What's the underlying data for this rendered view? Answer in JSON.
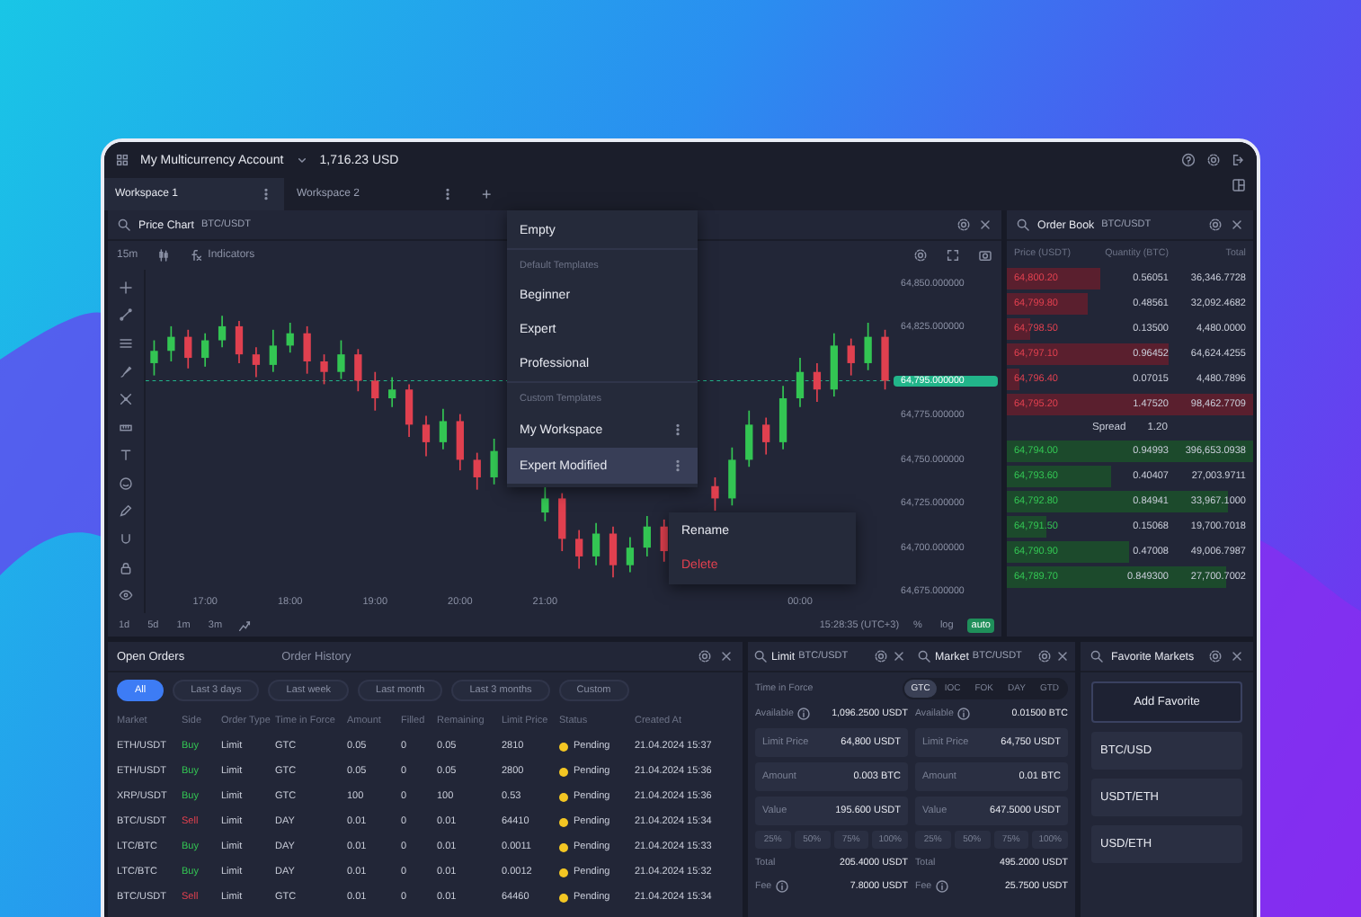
{
  "top_bar": {
    "account": "My Multicurrency Account",
    "balance": "1,716.23 USD"
  },
  "workspaces": [
    {
      "label": "Workspace 1",
      "selected": true
    },
    {
      "label": "Workspace 2",
      "selected": false
    }
  ],
  "add_tab": "+",
  "price_chart": {
    "title": "Price Chart",
    "pair": "BTC/USDT",
    "interval": "15m",
    "indicators": "Indicators",
    "chart_data": {
      "type": "candlestick",
      "x": [
        16.4,
        16.6,
        16.8,
        17.0,
        17.2,
        17.4,
        17.6,
        17.8,
        18.0,
        18.2,
        18.4,
        18.6,
        18.8,
        19.0,
        19.2,
        19.4,
        19.6,
        19.8,
        20.0,
        20.2,
        20.4,
        21.0,
        21.2,
        21.4,
        21.6,
        21.8,
        22.0,
        22.2,
        22.4,
        23.0,
        23.2,
        23.4,
        23.6,
        23.8,
        24.0,
        24.2,
        24.4,
        24.6,
        24.8,
        25.0
      ],
      "ohlc": [
        [
          64805,
          64818,
          64798,
          64812
        ],
        [
          64812,
          64826,
          64806,
          64820
        ],
        [
          64820,
          64824,
          64802,
          64808
        ],
        [
          64808,
          64822,
          64803,
          64818
        ],
        [
          64818,
          64832,
          64814,
          64826
        ],
        [
          64826,
          64829,
          64805,
          64810
        ],
        [
          64810,
          64814,
          64797,
          64804
        ],
        [
          64804,
          64824,
          64800,
          64815
        ],
        [
          64815,
          64828,
          64811,
          64822
        ],
        [
          64822,
          64826,
          64799,
          64806
        ],
        [
          64806,
          64810,
          64793,
          64800
        ],
        [
          64800,
          64818,
          64796,
          64810
        ],
        [
          64810,
          64813,
          64789,
          64795
        ],
        [
          64795,
          64800,
          64778,
          64785
        ],
        [
          64785,
          64797,
          64780,
          64790
        ],
        [
          64790,
          64793,
          64763,
          64770
        ],
        [
          64770,
          64775,
          64752,
          64760
        ],
        [
          64760,
          64779,
          64756,
          64772
        ],
        [
          64772,
          64776,
          64744,
          64750
        ],
        [
          64750,
          64754,
          64733,
          64740
        ],
        [
          64740,
          64762,
          64736,
          64755
        ],
        [
          64720,
          64735,
          64715,
          64728
        ],
        [
          64728,
          64731,
          64698,
          64705
        ],
        [
          64705,
          64710,
          64688,
          64695
        ],
        [
          64695,
          64714,
          64690,
          64708
        ],
        [
          64708,
          64712,
          64683,
          64690
        ],
        [
          64690,
          64706,
          64686,
          64700
        ],
        [
          64700,
          64718,
          64695,
          64712
        ],
        [
          64712,
          64716,
          64692,
          64698
        ],
        [
          64735,
          64740,
          64721,
          64728
        ],
        [
          64728,
          64757,
          64724,
          64750
        ],
        [
          64750,
          64778,
          64746,
          64770
        ],
        [
          64770,
          64774,
          64753,
          64760
        ],
        [
          64760,
          64792,
          64756,
          64785
        ],
        [
          64785,
          64808,
          64780,
          64800
        ],
        [
          64800,
          64805,
          64783,
          64790
        ],
        [
          64790,
          64822,
          64786,
          64815
        ],
        [
          64815,
          64819,
          64798,
          64805
        ],
        [
          64805,
          64828,
          64801,
          64820
        ],
        [
          64820,
          64824,
          64790,
          64795
        ]
      ],
      "xlim": [
        16.3,
        25.1
      ],
      "ylim": [
        64675,
        64850
      ],
      "ref_lines": [
        {
          "axis": "y",
          "value": 64795,
          "label": "64,795.000000"
        }
      ],
      "yticks": [
        {
          "value": 64850,
          "label": "64,850.000000"
        },
        {
          "value": 64825,
          "label": "64,825.000000"
        },
        {
          "value": 64775,
          "label": "64,775.000000"
        },
        {
          "value": 64750,
          "label": "64,750.000000"
        },
        {
          "value": 64725,
          "label": "64,725.000000"
        },
        {
          "value": 64700,
          "label": "64,700.000000"
        },
        {
          "value": 64675,
          "label": "64,675.000000"
        }
      ],
      "xticks": [
        {
          "value": 17,
          "label": "17:00"
        },
        {
          "value": 18,
          "label": "18:00"
        },
        {
          "value": 19,
          "label": "19:00"
        },
        {
          "value": 20,
          "label": "20:00"
        },
        {
          "value": 21,
          "label": "21:00"
        },
        {
          "value": 24,
          "label": "00:00"
        }
      ]
    },
    "ranges": [
      "1d",
      "5d",
      "1m",
      "3m"
    ],
    "clock": "15:28:35 (UTC+3)",
    "scale_options": [
      {
        "label": "%",
        "selected": false
      },
      {
        "label": "log",
        "selected": false
      },
      {
        "label": "auto",
        "selected": true
      }
    ]
  },
  "template_menu": {
    "items": [
      {
        "kind": "item",
        "label": "Empty",
        "selected": false
      },
      {
        "kind": "section",
        "label": "Default Templates"
      },
      {
        "kind": "item",
        "label": "Beginner",
        "selected": false
      },
      {
        "kind": "item",
        "label": "Expert",
        "selected": false
      },
      {
        "kind": "item",
        "label": "Professional",
        "selected": false
      },
      {
        "kind": "section",
        "label": "Custom Templates"
      },
      {
        "kind": "custom",
        "label": "My Workspace",
        "selected": false
      },
      {
        "kind": "custom",
        "label": "Expert Modified",
        "selected": true
      }
    ]
  },
  "context_menu": {
    "items": [
      {
        "kind": "normal",
        "label": "Rename"
      },
      {
        "kind": "danger",
        "label": "Delete"
      }
    ]
  },
  "order_book": {
    "title": "Order Book",
    "pair": "BTC/USDT",
    "columns": [
      "Price (USDT)",
      "Quantity (BTC)",
      "Total"
    ],
    "asks": [
      {
        "price": "64,800.20",
        "quantity": "0.56051",
        "total": "36,346.7728"
      },
      {
        "price": "64,799.80",
        "quantity": "0.48561",
        "total": "32,092.4682"
      },
      {
        "price": "64,798.50",
        "quantity": "0.13500",
        "total": "4,480.0000"
      },
      {
        "price": "64,797.10",
        "quantity": "0.96452",
        "total": "64,624.4255"
      },
      {
        "price": "64,796.40",
        "quantity": "0.07015",
        "total": "4,480.7896"
      },
      {
        "price": "64,795.20",
        "quantity": "1.47520",
        "total": "98,462.7709"
      }
    ],
    "spread_label": "Spread",
    "spread": "1.20",
    "bids": [
      {
        "price": "64,794.00",
        "quantity": "0.94993",
        "total": "396,653.0938"
      },
      {
        "price": "64,793.60",
        "quantity": "0.40407",
        "total": "27,003.9711"
      },
      {
        "price": "64,792.80",
        "quantity": "0.84941",
        "total": "33,967.1000"
      },
      {
        "price": "64,791.50",
        "quantity": "0.15068",
        "total": "19,700.7018"
      },
      {
        "price": "64,790.90",
        "quantity": "0.47008",
        "total": "49,006.7987"
      },
      {
        "price": "64,789.70",
        "quantity": "0.849300",
        "total": "27,700.7002"
      }
    ]
  },
  "open_orders": {
    "tabs": [
      {
        "label": "Open Orders",
        "selected": true
      },
      {
        "label": "Order History",
        "selected": false
      }
    ],
    "filters": [
      {
        "label": "All",
        "selected": true
      },
      {
        "label": "Last 3 days",
        "selected": false
      },
      {
        "label": "Last week",
        "selected": false
      },
      {
        "label": "Last month",
        "selected": false
      },
      {
        "label": "Last 3 months",
        "selected": false
      },
      {
        "label": "Custom",
        "selected": false
      }
    ],
    "columns": [
      "Market",
      "Side",
      "Order Type",
      "Time in Force",
      "Amount",
      "Filled",
      "Remaining",
      "Limit Price",
      "Status",
      "Created At"
    ],
    "rows": [
      {
        "kind": "buy",
        "cells": [
          "ETH/USDT",
          "Buy",
          "Limit",
          "GTC",
          "0.05",
          "0",
          "0.05",
          "2810",
          "Pending",
          "21.04.2024 15:37"
        ]
      },
      {
        "kind": "buy",
        "cells": [
          "ETH/USDT",
          "Buy",
          "Limit",
          "GTC",
          "0.05",
          "0",
          "0.05",
          "2800",
          "Pending",
          "21.04.2024 15:36"
        ]
      },
      {
        "kind": "buy",
        "cells": [
          "XRP/USDT",
          "Buy",
          "Limit",
          "GTC",
          "100",
          "0",
          "100",
          "0.53",
          "Pending",
          "21.04.2024 15:36"
        ]
      },
      {
        "kind": "sell",
        "cells": [
          "BTC/USDT",
          "Sell",
          "Limit",
          "DAY",
          "0.01",
          "0",
          "0.01",
          "64410",
          "Pending",
          "21.04.2024 15:34"
        ]
      },
      {
        "kind": "buy",
        "cells": [
          "LTC/BTC",
          "Buy",
          "Limit",
          "DAY",
          "0.01",
          "0",
          "0.01",
          "0.0011",
          "Pending",
          "21.04.2024 15:33"
        ]
      },
      {
        "kind": "buy",
        "cells": [
          "LTC/BTC",
          "Buy",
          "Limit",
          "DAY",
          "0.01",
          "0",
          "0.01",
          "0.0012",
          "Pending",
          "21.04.2024 15:32"
        ]
      },
      {
        "kind": "sell",
        "cells": [
          "BTC/USDT",
          "Sell",
          "Limit",
          "GTC",
          "0.01",
          "0",
          "0.01",
          "64460",
          "Pending",
          "21.04.2024 15:34"
        ]
      }
    ]
  },
  "order_entry": {
    "panels": [
      {
        "title": "Limit",
        "pair": "BTC/USDT"
      },
      {
        "title": "Market",
        "pair": "BTC/USDT"
      }
    ],
    "tif_label": "Time in Force",
    "tif_options": [
      {
        "label": "GTC",
        "selected": true
      },
      {
        "label": "IOC",
        "selected": false
      },
      {
        "label": "FOK",
        "selected": false
      },
      {
        "label": "DAY",
        "selected": false
      },
      {
        "label": "GTD",
        "selected": false
      }
    ],
    "forms": [
      {
        "available_label": "Available",
        "available": "1,096.2500 USDT",
        "fields": [
          {
            "label": "Limit Price",
            "value": "64,800 USDT"
          },
          {
            "label": "Amount",
            "value": "0.003 BTC"
          },
          {
            "label": "Value",
            "value": "195.600 USDT"
          }
        ],
        "percents": [
          "25%",
          "50%",
          "75%",
          "100%"
        ],
        "total_label": "Total",
        "total": "205.4000 USDT",
        "fee_label": "Fee",
        "fee": "7.8000 USDT"
      },
      {
        "available_label": "Available",
        "available": "0.01500 BTC",
        "fields": [
          {
            "label": "Limit Price",
            "value": "64,750 USDT"
          },
          {
            "label": "Amount",
            "value": "0.01 BTC"
          },
          {
            "label": "Value",
            "value": "647.5000 USDT"
          }
        ],
        "percents": [
          "25%",
          "50%",
          "75%",
          "100%"
        ],
        "total_label": "Total",
        "total": "495.2000 USDT",
        "fee_label": "Fee",
        "fee": "25.7500 USDT"
      }
    ]
  },
  "favorites": {
    "title": "Favorite Markets",
    "add": "Add Favorite",
    "markets": [
      "BTC/USD",
      "USDT/ETH",
      "USD/ETH"
    ]
  }
}
